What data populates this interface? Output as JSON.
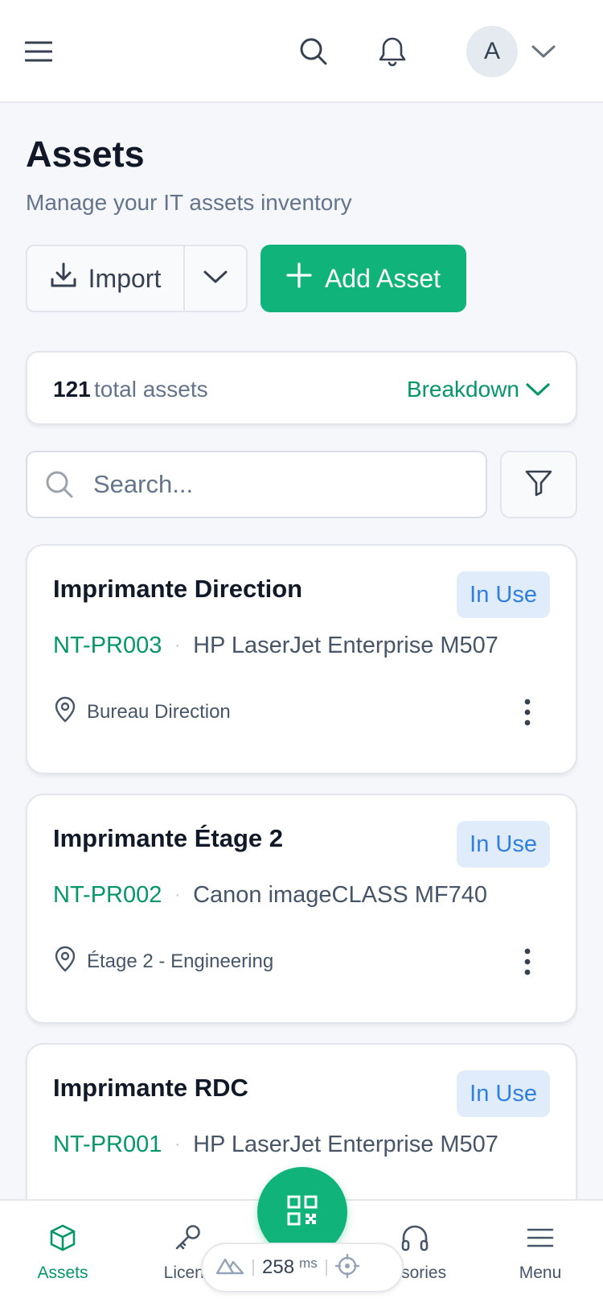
{
  "header": {
    "avatar_initial": "A"
  },
  "page": {
    "title": "Assets",
    "subtitle": "Manage your IT assets inventory"
  },
  "actions": {
    "import_label": "Import",
    "add_label": "Add Asset"
  },
  "summary": {
    "count": "121",
    "label": "total assets",
    "breakdown_label": "Breakdown"
  },
  "search": {
    "placeholder": "Search...",
    "value": ""
  },
  "assets": [
    {
      "name": "Imprimante Direction",
      "status": "In Use",
      "tag": "NT-PR003",
      "model": "HP LaserJet Enterprise M507",
      "location": "Bureau Direction"
    },
    {
      "name": "Imprimante Étage 2",
      "status": "In Use",
      "tag": "NT-PR002",
      "model": "Canon imageCLASS MF740",
      "location": "Étage 2 - Engineering"
    },
    {
      "name": "Imprimante RDC",
      "status": "In Use",
      "tag": "NT-PR001",
      "model": "HP LaserJet Enterprise M507",
      "location": ""
    }
  ],
  "nav": {
    "items": [
      {
        "label": "Assets",
        "icon": "cube-icon",
        "active": true
      },
      {
        "label": "Licens",
        "icon": "key-icon",
        "active": false
      },
      {
        "label": "essories",
        "icon": "headphones-icon",
        "active": false
      },
      {
        "label": "Menu",
        "icon": "menu-icon",
        "active": false
      }
    ]
  },
  "perf": {
    "value": "258",
    "unit": "ms"
  },
  "colors": {
    "accent": "#10b47a",
    "accent_text": "#059669",
    "status_bg": "#e1ecfb",
    "status_text": "#2f7fdf"
  }
}
